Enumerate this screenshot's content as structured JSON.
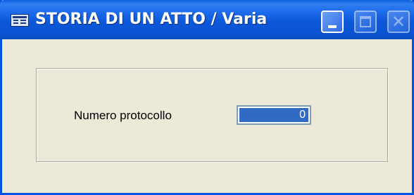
{
  "window": {
    "title": "STORIA DI UN ATTO / Varia",
    "icon": "window-form-icon",
    "buttons": {
      "minimize": "minimize-icon",
      "maximize": "maximize-icon",
      "close": "close-icon",
      "close_glyph": "✕"
    },
    "colors": {
      "titlebar": "#0a54d4",
      "background": "#ece9d8",
      "selection": "#316ac5"
    }
  },
  "form": {
    "protocol_label": "Numero protocollo",
    "protocol_value": "0"
  }
}
